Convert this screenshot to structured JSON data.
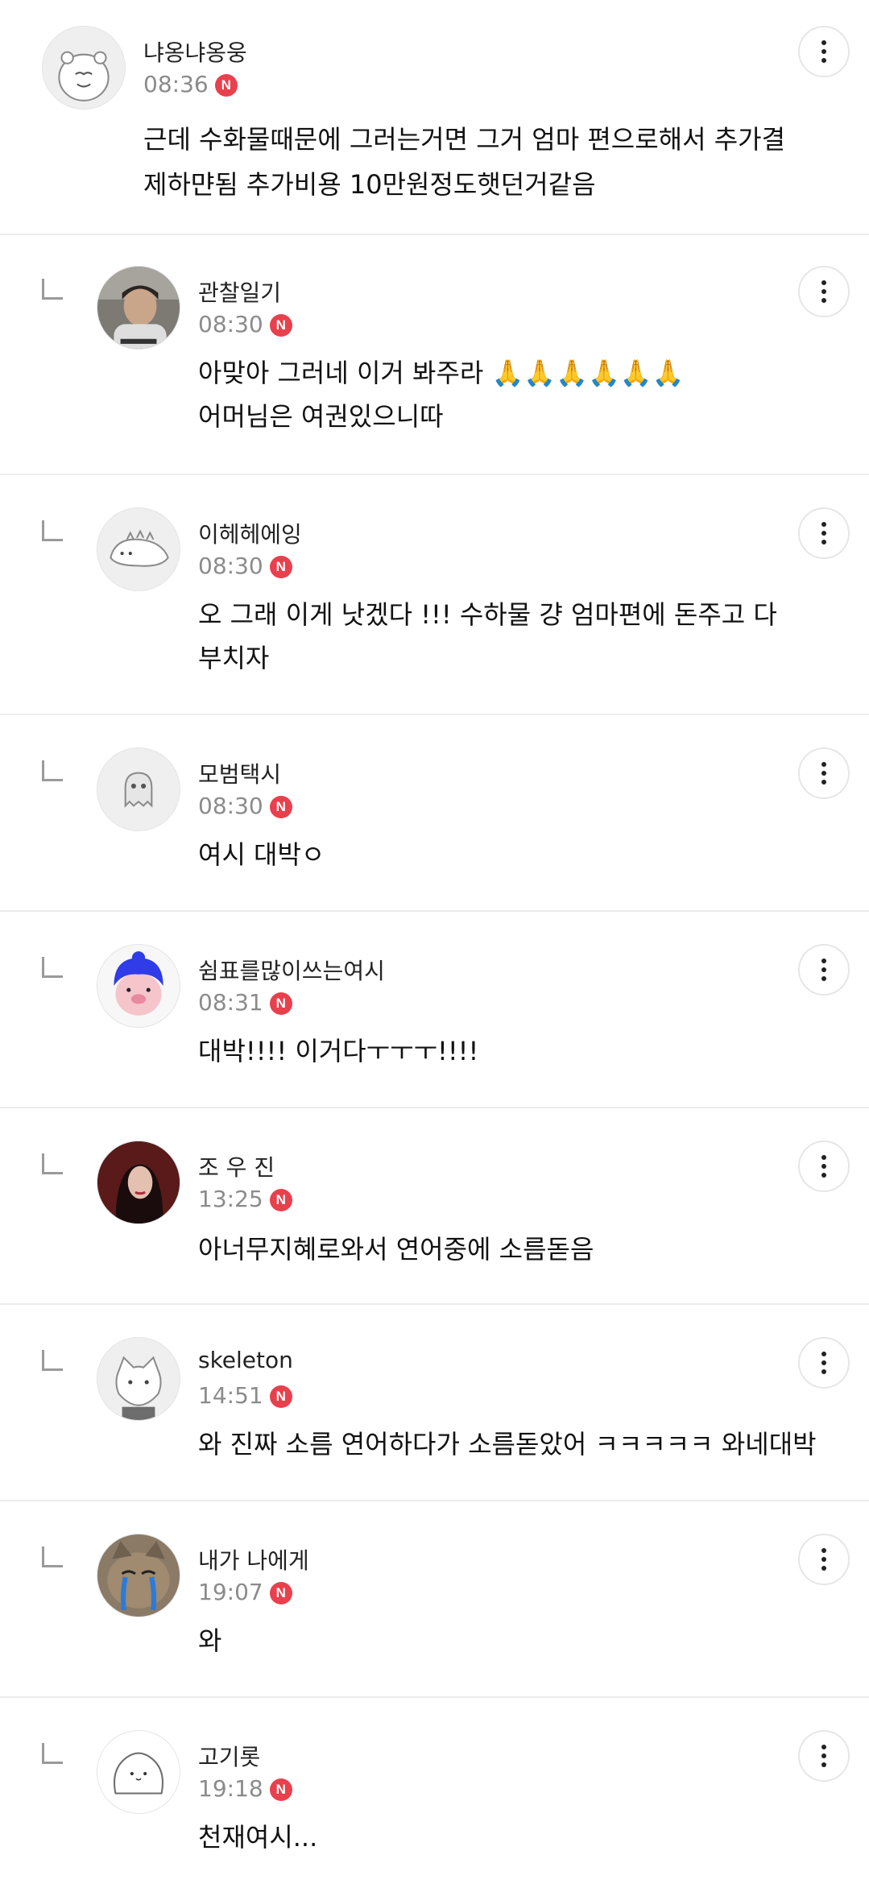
{
  "comments": [
    {
      "nick": "냐옹냐옹웅",
      "time": "08:36",
      "badge": "N",
      "reply": false,
      "avatar": "hamster-avatar-icon",
      "lines": [
        "근데 수화물때문에 그러는거면 그거 엄마 편으로해서 추가결",
        "제하먄됨 추가비용 10만원정도햇던거같음"
      ]
    },
    {
      "nick": "관찰일기",
      "time": "08:30",
      "badge": "N",
      "reply": true,
      "avatar": "man-photo-avatar",
      "lines": [
        "아맞아 그러네 이거 봐주라 🙏🙏🙏🙏🙏🙏",
        "어머님은 여권있으니따"
      ]
    },
    {
      "nick": "이헤헤에잉",
      "time": "08:30",
      "badge": "N",
      "reply": true,
      "avatar": "dinosaur-avatar-icon",
      "lines": [
        "오 그래 이게 낫겠다 !!! 수하물 걍 엄마편에 돈주고 다",
        "부치자"
      ]
    },
    {
      "nick": "모범택시",
      "time": "08:30",
      "badge": "N",
      "reply": true,
      "avatar": "ghost-avatar-icon",
      "lines": [
        "여시 대박ㅇ"
      ]
    },
    {
      "nick": "쉼표를많이쓰는여시",
      "time": "08:31",
      "badge": "N",
      "reply": true,
      "avatar": "pig-girl-avatar-icon",
      "lines": [
        "대박!!!! 이거다ㅜㅜㅜ!!!!"
      ]
    },
    {
      "nick": "조 우 진",
      "time": "13:25",
      "badge": "N",
      "reply": true,
      "avatar": "woman-photo-avatar",
      "lines": [
        "아너무지혜로와서 연어중에 소름돋음"
      ]
    },
    {
      "nick": "skeleton",
      "time": "14:51",
      "badge": "N",
      "reply": true,
      "avatar": "cat-avatar-icon",
      "lines": [
        "와 진짜 소름 연어하다가 소름돋았어 ㅋㅋㅋㅋㅋ 와네대박"
      ]
    },
    {
      "nick": "내가 나에게",
      "time": "19:07",
      "badge": "N",
      "reply": true,
      "avatar": "crying-cat-photo-avatar",
      "lines": [
        "와"
      ]
    },
    {
      "nick": "고기롯",
      "time": "19:18",
      "badge": "N",
      "reply": true,
      "avatar": "blob-avatar-icon",
      "lines": [
        "천재여시..."
      ]
    }
  ]
}
